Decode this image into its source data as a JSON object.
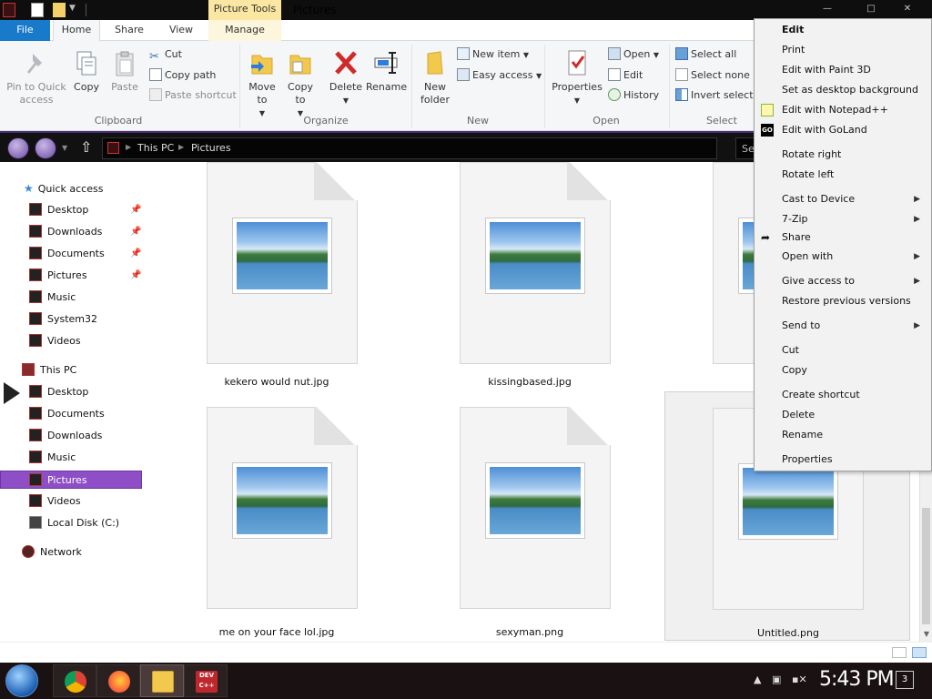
{
  "window": {
    "title": "Pictures",
    "contextual_tab_group": "Picture Tools"
  },
  "tabs": [
    "File",
    "Home",
    "Share",
    "View",
    "Manage"
  ],
  "ribbon": {
    "clipboard": {
      "pin_to_quick_access": "Pin to Quick access",
      "copy": "Copy",
      "paste": "Paste",
      "cut": "Cut",
      "copy_path": "Copy path",
      "paste_shortcut": "Paste shortcut",
      "label": "Clipboard"
    },
    "organize": {
      "move_to": "Move to",
      "copy_to": "Copy to",
      "delete": "Delete",
      "rename": "Rename",
      "label": "Organize"
    },
    "new": {
      "new_folder": "New folder",
      "new_item": "New item",
      "easy_access": "Easy access",
      "label": "New"
    },
    "open": {
      "properties": "Properties",
      "open": "Open",
      "edit": "Edit",
      "history": "History",
      "label": "Open"
    },
    "select": {
      "select_all": "Select all",
      "select_none": "Select none",
      "invert_selection": "Invert select",
      "label": "Select"
    }
  },
  "address": {
    "crumbs": [
      "This PC",
      "Pictures"
    ],
    "search_placeholder": "Se"
  },
  "nav": {
    "quick_access": "Quick access",
    "quick_items": [
      "Desktop",
      "Downloads",
      "Documents",
      "Pictures",
      "Music",
      "System32",
      "Videos"
    ],
    "this_pc": "This PC",
    "pc_items": [
      "Desktop",
      "Documents",
      "Downloads",
      "Music",
      "Pictures",
      "Videos",
      "Local Disk (C:)"
    ],
    "network": "Network",
    "selected": "Pictures"
  },
  "files": [
    {
      "name": "kekero would nut.jpg"
    },
    {
      "name": "kissingbased.jpg"
    },
    {
      "name": ""
    },
    {
      "name": "me on your face lol.jpg"
    },
    {
      "name": "sexyman.png"
    },
    {
      "name": "Untitled.png",
      "selected": true
    }
  ],
  "context_menu": {
    "items": [
      {
        "label": "Edit",
        "bold": true
      },
      {
        "label": "Print"
      },
      {
        "label": "Edit with Paint 3D"
      },
      {
        "label": "Set as desktop background"
      },
      {
        "label": "Edit with Notepad++",
        "icon": "notepad-plus-plus-icon"
      },
      {
        "label": "Edit with GoLand",
        "icon": "goland-icon"
      },
      {
        "label": "Rotate right"
      },
      {
        "label": "Rotate left"
      },
      {
        "label": "Cast to Device",
        "submenu": true
      },
      {
        "label": "7-Zip",
        "submenu": true
      },
      {
        "label": "Share",
        "icon": "share-icon"
      },
      {
        "label": "Open with",
        "submenu": true
      },
      {
        "label": "Give access to",
        "submenu": true
      },
      {
        "label": "Restore previous versions"
      },
      {
        "label": "Send to",
        "submenu": true
      },
      {
        "label": "Cut"
      },
      {
        "label": "Copy"
      },
      {
        "label": "Create shortcut"
      },
      {
        "label": "Delete"
      },
      {
        "label": "Rename"
      },
      {
        "label": "Properties"
      }
    ]
  },
  "taskbar": {
    "apps": [
      "chrome-icon",
      "firefox-icon",
      "file-explorer-icon",
      "dev-cpp-icon"
    ],
    "dev_cpp_label": "DEV C++",
    "clock": "5:43 PM",
    "notifications": "3"
  },
  "colors": {
    "file_tab": "#1979ca",
    "selection": "#8e4ec6",
    "picture_tools": "#fbe7a1",
    "taskbar": "#1a1212",
    "titlebar": "#0e0e0e"
  }
}
